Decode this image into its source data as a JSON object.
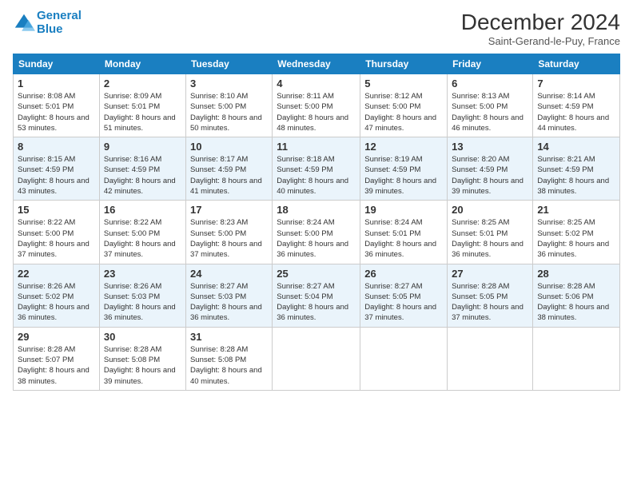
{
  "header": {
    "logo_line1": "General",
    "logo_line2": "Blue",
    "month": "December 2024",
    "location": "Saint-Gerand-le-Puy, France"
  },
  "weekdays": [
    "Sunday",
    "Monday",
    "Tuesday",
    "Wednesday",
    "Thursday",
    "Friday",
    "Saturday"
  ],
  "weeks": [
    [
      {
        "day": "1",
        "sunrise": "Sunrise: 8:08 AM",
        "sunset": "Sunset: 5:01 PM",
        "daylight": "Daylight: 8 hours and 53 minutes."
      },
      {
        "day": "2",
        "sunrise": "Sunrise: 8:09 AM",
        "sunset": "Sunset: 5:01 PM",
        "daylight": "Daylight: 8 hours and 51 minutes."
      },
      {
        "day": "3",
        "sunrise": "Sunrise: 8:10 AM",
        "sunset": "Sunset: 5:00 PM",
        "daylight": "Daylight: 8 hours and 50 minutes."
      },
      {
        "day": "4",
        "sunrise": "Sunrise: 8:11 AM",
        "sunset": "Sunset: 5:00 PM",
        "daylight": "Daylight: 8 hours and 48 minutes."
      },
      {
        "day": "5",
        "sunrise": "Sunrise: 8:12 AM",
        "sunset": "Sunset: 5:00 PM",
        "daylight": "Daylight: 8 hours and 47 minutes."
      },
      {
        "day": "6",
        "sunrise": "Sunrise: 8:13 AM",
        "sunset": "Sunset: 5:00 PM",
        "daylight": "Daylight: 8 hours and 46 minutes."
      },
      {
        "day": "7",
        "sunrise": "Sunrise: 8:14 AM",
        "sunset": "Sunset: 4:59 PM",
        "daylight": "Daylight: 8 hours and 44 minutes."
      }
    ],
    [
      {
        "day": "8",
        "sunrise": "Sunrise: 8:15 AM",
        "sunset": "Sunset: 4:59 PM",
        "daylight": "Daylight: 8 hours and 43 minutes."
      },
      {
        "day": "9",
        "sunrise": "Sunrise: 8:16 AM",
        "sunset": "Sunset: 4:59 PM",
        "daylight": "Daylight: 8 hours and 42 minutes."
      },
      {
        "day": "10",
        "sunrise": "Sunrise: 8:17 AM",
        "sunset": "Sunset: 4:59 PM",
        "daylight": "Daylight: 8 hours and 41 minutes."
      },
      {
        "day": "11",
        "sunrise": "Sunrise: 8:18 AM",
        "sunset": "Sunset: 4:59 PM",
        "daylight": "Daylight: 8 hours and 40 minutes."
      },
      {
        "day": "12",
        "sunrise": "Sunrise: 8:19 AM",
        "sunset": "Sunset: 4:59 PM",
        "daylight": "Daylight: 8 hours and 39 minutes."
      },
      {
        "day": "13",
        "sunrise": "Sunrise: 8:20 AM",
        "sunset": "Sunset: 4:59 PM",
        "daylight": "Daylight: 8 hours and 39 minutes."
      },
      {
        "day": "14",
        "sunrise": "Sunrise: 8:21 AM",
        "sunset": "Sunset: 4:59 PM",
        "daylight": "Daylight: 8 hours and 38 minutes."
      }
    ],
    [
      {
        "day": "15",
        "sunrise": "Sunrise: 8:22 AM",
        "sunset": "Sunset: 5:00 PM",
        "daylight": "Daylight: 8 hours and 37 minutes."
      },
      {
        "day": "16",
        "sunrise": "Sunrise: 8:22 AM",
        "sunset": "Sunset: 5:00 PM",
        "daylight": "Daylight: 8 hours and 37 minutes."
      },
      {
        "day": "17",
        "sunrise": "Sunrise: 8:23 AM",
        "sunset": "Sunset: 5:00 PM",
        "daylight": "Daylight: 8 hours and 37 minutes."
      },
      {
        "day": "18",
        "sunrise": "Sunrise: 8:24 AM",
        "sunset": "Sunset: 5:00 PM",
        "daylight": "Daylight: 8 hours and 36 minutes."
      },
      {
        "day": "19",
        "sunrise": "Sunrise: 8:24 AM",
        "sunset": "Sunset: 5:01 PM",
        "daylight": "Daylight: 8 hours and 36 minutes."
      },
      {
        "day": "20",
        "sunrise": "Sunrise: 8:25 AM",
        "sunset": "Sunset: 5:01 PM",
        "daylight": "Daylight: 8 hours and 36 minutes."
      },
      {
        "day": "21",
        "sunrise": "Sunrise: 8:25 AM",
        "sunset": "Sunset: 5:02 PM",
        "daylight": "Daylight: 8 hours and 36 minutes."
      }
    ],
    [
      {
        "day": "22",
        "sunrise": "Sunrise: 8:26 AM",
        "sunset": "Sunset: 5:02 PM",
        "daylight": "Daylight: 8 hours and 36 minutes."
      },
      {
        "day": "23",
        "sunrise": "Sunrise: 8:26 AM",
        "sunset": "Sunset: 5:03 PM",
        "daylight": "Daylight: 8 hours and 36 minutes."
      },
      {
        "day": "24",
        "sunrise": "Sunrise: 8:27 AM",
        "sunset": "Sunset: 5:03 PM",
        "daylight": "Daylight: 8 hours and 36 minutes."
      },
      {
        "day": "25",
        "sunrise": "Sunrise: 8:27 AM",
        "sunset": "Sunset: 5:04 PM",
        "daylight": "Daylight: 8 hours and 36 minutes."
      },
      {
        "day": "26",
        "sunrise": "Sunrise: 8:27 AM",
        "sunset": "Sunset: 5:05 PM",
        "daylight": "Daylight: 8 hours and 37 minutes."
      },
      {
        "day": "27",
        "sunrise": "Sunrise: 8:28 AM",
        "sunset": "Sunset: 5:05 PM",
        "daylight": "Daylight: 8 hours and 37 minutes."
      },
      {
        "day": "28",
        "sunrise": "Sunrise: 8:28 AM",
        "sunset": "Sunset: 5:06 PM",
        "daylight": "Daylight: 8 hours and 38 minutes."
      }
    ],
    [
      {
        "day": "29",
        "sunrise": "Sunrise: 8:28 AM",
        "sunset": "Sunset: 5:07 PM",
        "daylight": "Daylight: 8 hours and 38 minutes."
      },
      {
        "day": "30",
        "sunrise": "Sunrise: 8:28 AM",
        "sunset": "Sunset: 5:08 PM",
        "daylight": "Daylight: 8 hours and 39 minutes."
      },
      {
        "day": "31",
        "sunrise": "Sunrise: 8:28 AM",
        "sunset": "Sunset: 5:08 PM",
        "daylight": "Daylight: 8 hours and 40 minutes."
      },
      null,
      null,
      null,
      null
    ]
  ]
}
